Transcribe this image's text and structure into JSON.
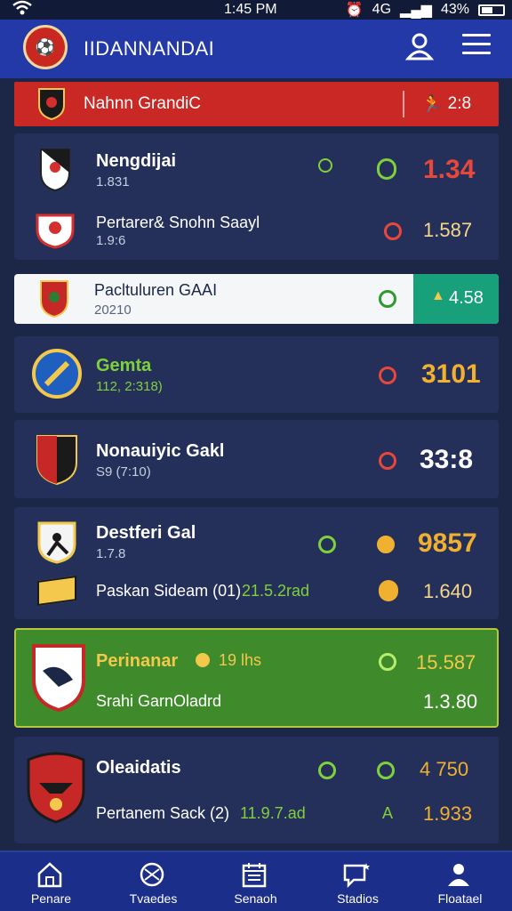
{
  "status_bar": {
    "time": "1:45 PM",
    "network": "4G",
    "battery": "43%"
  },
  "header": {
    "title": "IIDANNANDAI",
    "user_icon": "user-icon",
    "menu_icon": "menu-icon"
  },
  "featured": {
    "title": "Nahnn GrandiC",
    "value": "2:8"
  },
  "matches": [
    {
      "home": "Nengdijai",
      "home_sub": "1.831",
      "home_odd": "1.34",
      "away": "Pertarer& Snohn Saayl",
      "away_sub": "1.9:6",
      "away_odd": "1.587"
    },
    {
      "name": "Pacltuluren GAAI",
      "sub": "20210",
      "odd": "4.58"
    },
    {
      "name": "Gemta",
      "sub": "112, 2:318)",
      "odd": "3101"
    },
    {
      "name": "Nonauiyic Gakl",
      "sub": "S9 (7:10)",
      "odd": "33:8"
    },
    {
      "home": "Destferi Gal",
      "home_sub": "1.7.8",
      "home_odd": "9857",
      "away": "Paskan Sideam (01)",
      "away_extra": "21.5.2rad",
      "away_odd": "1.640"
    },
    {
      "home": "Perinanar",
      "home_extra": "19 lhs",
      "home_odd": "15.587",
      "away": "Srahi GarnOladrd",
      "away_odd": "1.3.80"
    },
    {
      "home": "Oleaidatis",
      "home_odd": "4 750",
      "away": "Pertanem Sack (2)",
      "away_extra": "11.9.7.ad",
      "away_mark": "A",
      "away_odd": "1.933"
    }
  ],
  "tabs": [
    {
      "label": "Penare",
      "icon": "home-icon"
    },
    {
      "label": "Tvaedes",
      "icon": "ball-icon"
    },
    {
      "label": "Senaoh",
      "icon": "calendar-icon"
    },
    {
      "label": "Stadios",
      "icon": "chat-star-icon"
    },
    {
      "label": "Floatael",
      "icon": "profile-icon"
    }
  ],
  "colors": {
    "header": "#2339a8",
    "background": "#1c2748",
    "card": "#25305a",
    "featured": "#c92824",
    "highlight_green": "#3f8a2a",
    "teal": "#18a07a",
    "accent_orange": "#f0a030",
    "red_odd": "#e8483c"
  }
}
